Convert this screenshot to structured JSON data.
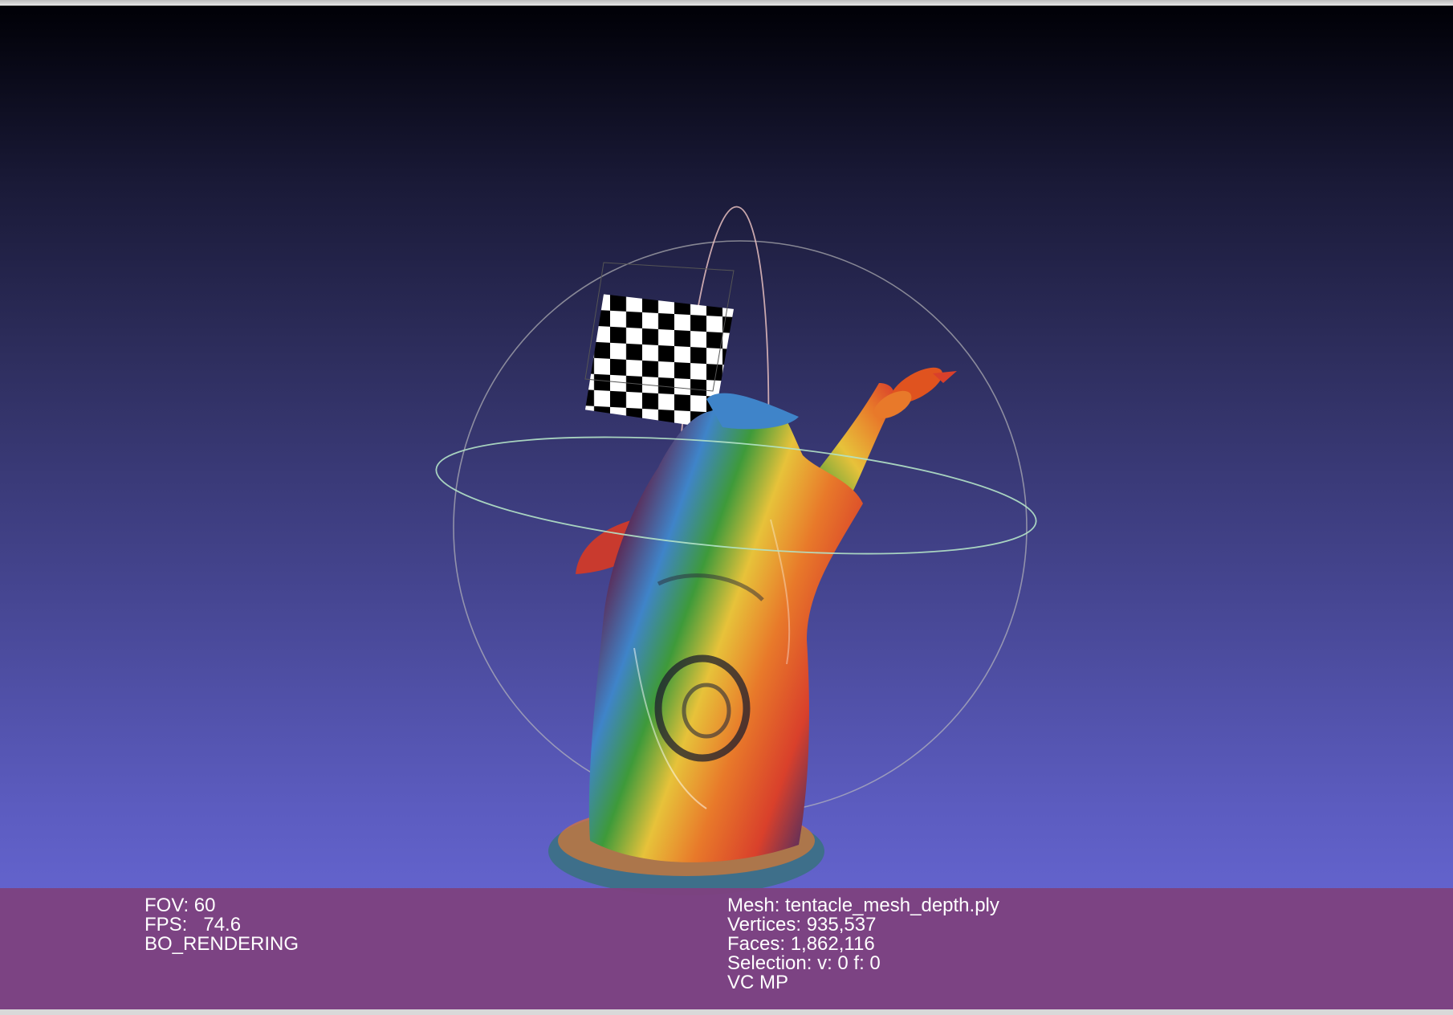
{
  "viewport": {
    "background_top": "#000006",
    "background_bottom": "#6d6ddf"
  },
  "overlay": {
    "color": "#7d4280",
    "left": {
      "fov": "FOV: 60",
      "fps_label": "FPS:",
      "fps_value": "74.6",
      "rendering_mode": "BO_RENDERING"
    },
    "right": {
      "mesh": "Mesh: tentacle_mesh_depth.ply",
      "vertices": "Vertices: 935,537",
      "faces": "Faces: 1,862,116",
      "selection": "Selection: v: 0 f: 0",
      "mode": "VC MP"
    }
  },
  "trackball": {
    "color": "#cfcfcf"
  },
  "model": {
    "colors": [
      "#d9402b",
      "#e8792a",
      "#e7c23a",
      "#3e9a3a",
      "#3f84c9",
      "#5a2f5c"
    ]
  }
}
